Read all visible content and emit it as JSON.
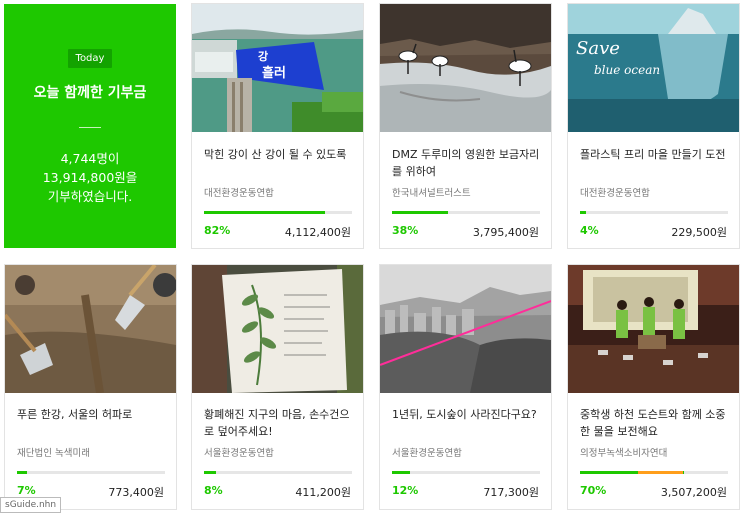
{
  "summary": {
    "badge": "Today",
    "title": "오늘 함께한 기부금",
    "line1": "4,744명이",
    "line2": "13,914,800원을",
    "line3": "기부하였습니다."
  },
  "cards": [
    {
      "title": "막힌 강이 산 강이 될 수 있도록",
      "org": "대전환경운동연합",
      "percent": "82%",
      "progress": 0.82,
      "amount": "4,112,400원",
      "banner_text1": "흘러",
      "banner_text2": "강"
    },
    {
      "title": "DMZ 두루미의 영원한 보금자리를 위하여",
      "org": "한국내셔널트러스트",
      "percent": "38%",
      "progress": 0.38,
      "amount": "3,795,400원"
    },
    {
      "title": "플라스틱 프리 마을 만들기 도전",
      "org": "대전환경운동연합",
      "percent": "4%",
      "progress": 0.04,
      "amount": "229,500원",
      "image_text1": "Save",
      "image_text2": "blue ocean"
    },
    {
      "title": "푸른 한강, 서울의 허파로",
      "org": "재단법인 녹색미래",
      "percent": "7%",
      "progress": 0.07,
      "amount": "773,400원"
    },
    {
      "title": "황폐해진 지구의 마음, 손수건으로 덮어주세요!",
      "org": "서울환경운동연합",
      "percent": "8%",
      "progress": 0.08,
      "amount": "411,200원"
    },
    {
      "title": "1년뒤, 도시숲이 사라진다구요?",
      "org": "서울환경운동연합",
      "percent": "12%",
      "progress": 0.12,
      "amount": "717,300원"
    },
    {
      "title": "중학생 하천 도슨트와 함께 소중한 물을 보전해요",
      "org": "의정부녹색소비자연대",
      "percent": "70%",
      "progress": 0.7,
      "progress_extra": 0.4,
      "amount": "3,507,200원"
    }
  ],
  "tooltip": "sGuide.nhn",
  "colors": {
    "accent": "#1ec800",
    "secondary": "#ff9e1b"
  }
}
